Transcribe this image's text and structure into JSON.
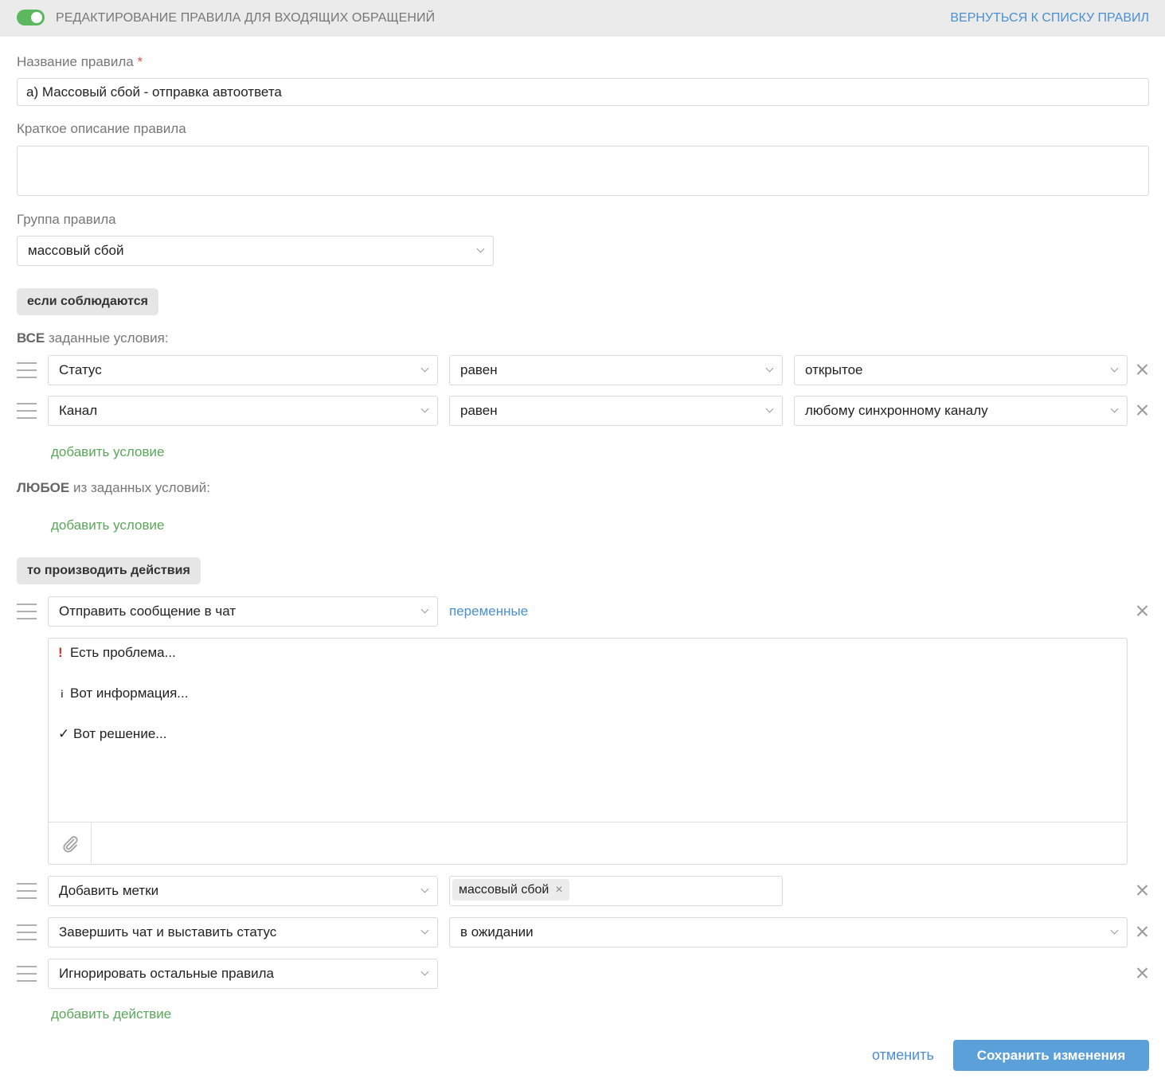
{
  "header": {
    "title": "РЕДАКТИРОВАНИЕ ПРАВИЛА ДЛЯ ВХОДЯЩИХ ОБРАЩЕНИЙ",
    "back_link": "ВЕРНУТЬСЯ К СПИСКУ ПРАВИЛ",
    "rule_enabled": true,
    "toggle_color": "#5cb85c"
  },
  "form": {
    "name_label": "Название правила",
    "required_mark": "*",
    "name_value": "а) Массовый сбой - отправка автоответа",
    "description_label": "Краткое описание правила",
    "description_value": "",
    "group_label": "Группа правила",
    "group_value": "массовый сбой"
  },
  "conditions": {
    "section_label": "если соблюдаются",
    "all_prefix": "ВСЕ",
    "all_suffix": " заданные условия:",
    "all_rows": [
      {
        "field": "Статус",
        "operator": "равен",
        "value": "открытое"
      },
      {
        "field": "Канал",
        "operator": "равен",
        "value": "любому синхронному каналу"
      }
    ],
    "add_condition": "добавить условие",
    "any_prefix": "ЛЮБОЕ",
    "any_suffix": " из заданных условий:",
    "add_condition_any": "добавить условие"
  },
  "actions": {
    "section_label": "то производить действия",
    "send_message": {
      "action": "Отправить сообщение в чат",
      "variables_link": "переменные",
      "lines": [
        {
          "icon": "!",
          "text": "Есть проблема..."
        },
        {
          "icon": "i",
          "text": "Вот информация..."
        },
        {
          "icon": "✓",
          "text": "Вот решение..."
        }
      ]
    },
    "add_tags": {
      "action": "Добавить метки",
      "tag": "массовый сбой",
      "tag_remove": "×"
    },
    "close_chat": {
      "action": "Завершить чат и выставить статус",
      "value": "в ожидании"
    },
    "ignore_rules": {
      "action": "Игнорировать остальные правила"
    },
    "add_action": "добавить действие"
  },
  "footer": {
    "cancel": "отменить",
    "save": "Сохранить изменения"
  },
  "colors": {
    "accent_blue": "#4a90d0",
    "link_green": "#5aa75a",
    "save_button": "#5ba0d8",
    "alert_red": "#d9534f"
  }
}
